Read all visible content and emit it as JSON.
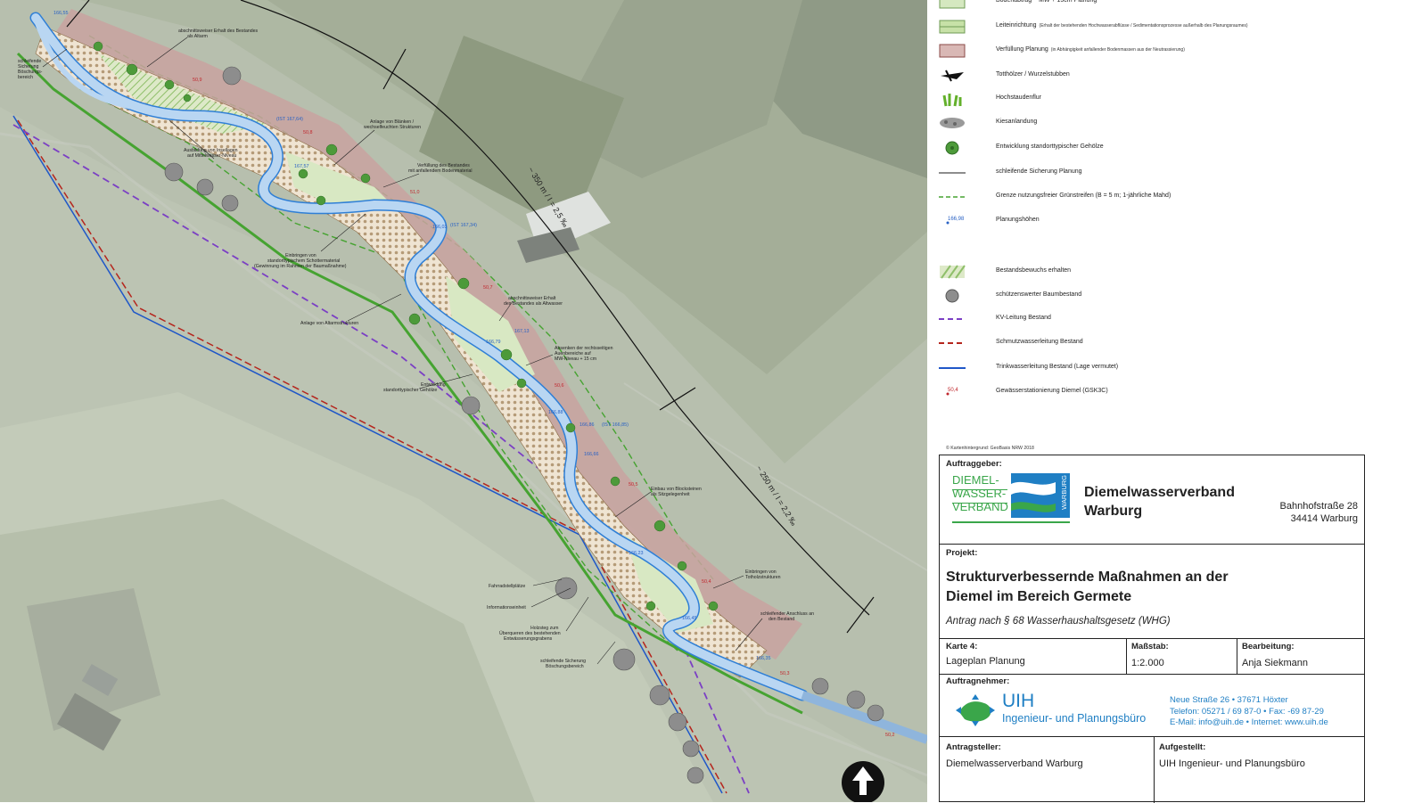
{
  "map": {
    "labels": {
      "teilerhalt_altarm": "abschnittsweiser Erhalt des Bestandes",
      "teilerhalt_altarm2": "als Altarm",
      "boeschung1": "schleifende",
      "boeschung2": "Sicherung",
      "boeschung3": "Böschungs-",
      "boeschung4": "bereich",
      "blaenken1": "Anlage von Blänken /",
      "blaenken2": "wechselfeuchten Strukturen",
      "inselausbildung1": "Ausbildung von Insellagen",
      "inselausbildung2": "auf Mittelwasser-Niveau",
      "verfuellung1": "Verfüllung des Bestandes",
      "verfuellung2": "mit anfallendem Bodenmaterial",
      "schottermat1": "Einbringen von",
      "schottermat2": "standorttypischem Schottermaterial",
      "schottermat3": "(Gewinnung im Rahmen der Baumaßnahme)",
      "altarmstrukturen": "Anlage von Altarmstrukturen",
      "teilerhalt2_1": "abschnittsweiser Erhalt",
      "teilerhalt2_2": "des Bestandes als Altwasser",
      "absenken1": "Absenken der rechtsseitigen",
      "absenken2": "Auenbereiche auf",
      "absenken3": "MW-Niveau + 15 cm",
      "gehoelze1": "Entwicklung",
      "gehoelze2": "standorttypischer Gehölze",
      "blocksteine1": "Einbau von Blocksteinen",
      "blocksteine2": "als Sitzgelegenheit",
      "totholz1": "Einbringen von",
      "totholz2": "Totholzstrukturen",
      "fahrrad": "Fahrradstellplätze",
      "info": "Informationseinheit",
      "holzsteg1": "Holzsteg zum",
      "holzsteg2": "Überqueren des bestehenden",
      "holzsteg3": "Entwässerungsgrabens",
      "boeschung_s1": "schleifende Sicherung",
      "boeschung_s2": "Böschungsbereich",
      "anschluss1": "schleifender Anschluss an",
      "anschluss2": "den Bestand"
    },
    "heights": [
      "166,55",
      "(IST 167,64)",
      "167,57",
      "(IST 167,34)",
      "166,03",
      "167,13",
      "166,79",
      "166,88",
      "166,86",
      "(IST 166,85)",
      "166,66",
      "166,23",
      "166,45",
      "166,35"
    ],
    "stations": [
      "50,8",
      "50,7",
      "50,6",
      "50,5",
      "50,4",
      "50,3",
      "50,2",
      "51,0",
      "50,9"
    ],
    "dimension_upper": "~ 350 m / I = 2,5 ‰",
    "dimension_lower": "~ 250 m / I = 2,2 ‰"
  },
  "legend": {
    "items": [
      {
        "label": "Bodenabtrag ~ MW + 15cm Planung",
        "small": ""
      },
      {
        "label": "Leiteinrichtung",
        "small": "(Erhalt der bestehenden Hochwasserabflüsse / Sedimentationsprozesse außerhalb des Planungsraumes)"
      },
      {
        "label": "Verfüllung Planung",
        "small": "(in Abhängigkeit anfallender Bodenmassen aus der Neutrassierung)"
      },
      {
        "label": "Totthölzer / Wurzelstubben",
        "small": ""
      },
      {
        "label": "Hochstaudenflur",
        "small": ""
      },
      {
        "label": "Kiesanlandung",
        "small": ""
      },
      {
        "label": "Entwicklung standorttypischer Gehölze",
        "small": ""
      },
      {
        "label": "schleifende Sicherung Planung",
        "small": ""
      },
      {
        "label": "Grenze nutzungsfreier Grünstreifen (B = 5 m; 1-jährliche Mahd)",
        "small": ""
      },
      {
        "label": "Planungshöhen",
        "small": "",
        "value": "166,98"
      },
      {
        "label": "Bestandsbewuchs erhalten",
        "small": ""
      },
      {
        "label": "schützenswerter Baumbestand",
        "small": ""
      },
      {
        "label": "KV-Leitung Bestand",
        "small": ""
      },
      {
        "label": "Schmutzwasserleitung Bestand",
        "small": ""
      },
      {
        "label": "Trinkwasserleitung Bestand (Lage vermutet)",
        "small": ""
      },
      {
        "label": "Gewässerstationierung Diemel (GSK3C)",
        "small": "",
        "value": "50,4"
      }
    ],
    "copyright": "© Kartenhintergrund: GeoBasis NRW 2018"
  },
  "titleblock": {
    "auftraggeber_label": "Auftraggeber:",
    "logo_lines": [
      "DIEMEL-",
      "WASSER-",
      "VERBAND"
    ],
    "logo_vertical": "WARBURG",
    "client_name1": "Diemelwasserverband",
    "client_name2": "Warburg",
    "client_street": "Bahnhofstraße 28",
    "client_city": "34414 Warburg",
    "projekt_label": "Projekt:",
    "projekt_title1": "Strukturverbessernde Maßnahmen an der",
    "projekt_title2": "Diemel im Bereich Germete",
    "projekt_sub": "Antrag nach § 68 Wasserhaushaltsgesetz (WHG)",
    "karte_label": "Karte 4:",
    "karte_value": "Lageplan Planung",
    "massstab_label": "Maßstab:",
    "massstab_value": "1:2.000",
    "bearbeitung_label": "Bearbeitung:",
    "bearbeitung_value": "Anja Siekmann",
    "auftragnehmer_label": "Auftragnehmer:",
    "uih_name": "UIH",
    "uih_sub": "Ingenieur- und Planungsbüro",
    "uih_addr1": "Neue Straße 26  •  37671 Höxter",
    "uih_addr2": "Telefon: 05271 / 69 87-0  •  Fax:  -69 87-29",
    "uih_addr3": "E-Mail: info@uih.de  •  Internet: www.uih.de",
    "antragsteller_label": "Antragsteller:",
    "antragsteller_value": "Diemelwasserverband Warburg",
    "aufgestellt_label": "Aufgestellt:",
    "aufgestellt_value": "UIH Ingenieur- und Planungsbüro"
  },
  "colors": {
    "river": "#b9d6f2",
    "river_edge": "#2f7fd6",
    "fill_pink": "#c9a2a0",
    "green_line": "#46a331",
    "kv_purple": "#7b3fc4",
    "sewer_red": "#b5251d",
    "water_blue": "#1f57c8",
    "logo_green": "#3aa64a",
    "logo_blue": "#1f7fc4"
  }
}
